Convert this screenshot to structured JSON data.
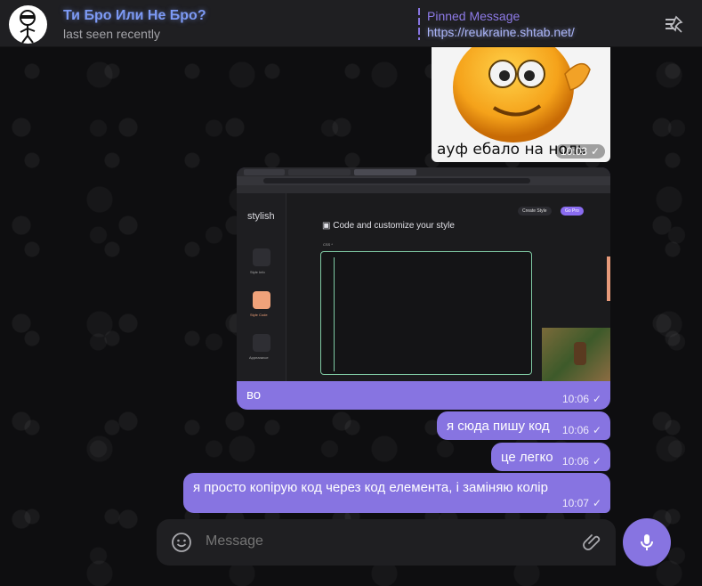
{
  "header": {
    "title": "Ти Бро Или Не Бро?",
    "status": "last seen recently",
    "pinned_label": "Pinned Message",
    "pinned_text": "https://reukraine.shtab.net/"
  },
  "messages": [
    {
      "type": "sticker",
      "caption": "ауф ебало на ноль",
      "time": "10:03"
    },
    {
      "type": "photo",
      "caption": "во",
      "time": "10:06",
      "screenshot": {
        "brand": "stylish",
        "heading": "Code and customize your style",
        "nav": [
          "Style Info",
          "Style Code",
          "Appearance"
        ],
        "buttons": [
          "Create Style",
          "Go Pro"
        ],
        "field_label": "CSS *"
      }
    },
    {
      "type": "text",
      "text": "я сюда пишу код",
      "time": "10:06"
    },
    {
      "type": "text",
      "text": "це легко",
      "time": "10:06"
    },
    {
      "type": "text",
      "text": "я просто копірую код через код елемента, і заміняю колір",
      "time": "10:07"
    }
  ],
  "composer": {
    "placeholder": "Message"
  },
  "colors": {
    "accent": "#8774e1",
    "header_bg": "#1f1f22",
    "title": "#7d9af5",
    "chat_bg": "#0e0e10"
  },
  "icons": [
    "avatar-stickman",
    "unpin-icon",
    "emoji-icon",
    "attach-icon",
    "mic-icon",
    "read-check-icon"
  ]
}
